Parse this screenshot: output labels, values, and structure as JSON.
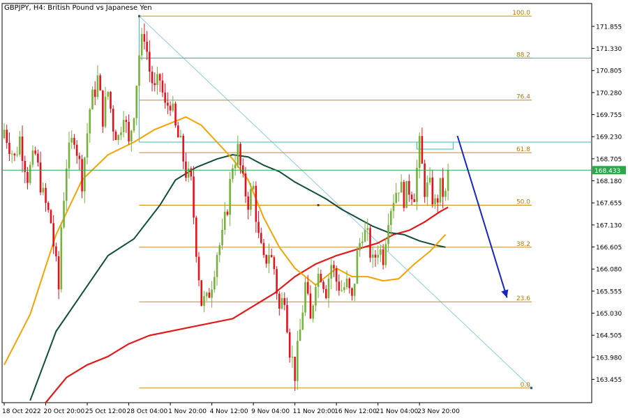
{
  "header": {
    "title": "GBPJPY, H4:  British Pound vs Japanese Yen"
  },
  "colors": {
    "bull": "#74b33a",
    "bear": "#e8101c",
    "ma_orange": "#f5a300",
    "ma_darkgreen": "#0f4f3a",
    "ma_red": "#e21a1a",
    "fib": "#c98a12",
    "cyan": "#35bcc1",
    "current_line": "#2aa84a",
    "arrow": "#1625c8"
  },
  "icons": {
    "projection_arrow": "arrow-down-icon"
  },
  "chart_data": {
    "type": "candlestick",
    "symbol": "GBPJPY",
    "timeframe": "H4",
    "ylim": [
      162.9,
      172.4
    ],
    "y_ticks": [
      171.855,
      171.33,
      170.805,
      170.28,
      169.755,
      169.23,
      168.705,
      168.18,
      167.655,
      167.13,
      166.605,
      166.08,
      165.555,
      165.03,
      164.505,
      163.98,
      163.455
    ],
    "x_ticks": [
      "18 Oct 2022",
      "20 Oct 20:00",
      "25 Oct 12:00",
      "28 Oct 04:00",
      "1 Nov 20:00",
      "4 Nov 12:00",
      "9 Nov 04:00",
      "11 Nov 20:00",
      "16 Nov 12:00",
      "21 Nov 04:00",
      "23 Nov 20:00"
    ],
    "x_tick_bars": [
      0,
      16,
      32,
      48,
      64,
      80,
      96,
      112,
      128,
      144,
      160
    ],
    "n_bars": 172,
    "current_price": 168.433,
    "current_price_label": "168.433",
    "fibonacci": {
      "start_bar": 52,
      "end_bar": 190,
      "levels": [
        {
          "label": "100.0",
          "price": 172.1
        },
        {
          "label": "88.2",
          "price": 171.1
        },
        {
          "label": "76.4",
          "price": 170.1
        },
        {
          "label": "61.8",
          "price": 168.85
        },
        {
          "label": "50.0",
          "price": 167.6
        },
        {
          "label": "38.2",
          "price": 166.6
        },
        {
          "label": "23.6",
          "price": 165.3
        },
        {
          "label": "0.0",
          "price": 163.25
        }
      ],
      "high": {
        "bar": 52,
        "price": 172.1
      },
      "low": {
        "bar": 190,
        "price": 163.25
      },
      "mid_marker": {
        "bar": 121,
        "price": 167.6
      }
    },
    "cyan_lines": [
      171.1,
      169.1
    ],
    "supply_zone": {
      "x_start_bar": 159,
      "x_end_bar": 173,
      "y_top": 169.1,
      "y_bottom": 168.98
    },
    "projection_arrow": {
      "from_bar": 173,
      "from_price": 169.25,
      "to_bar": 191,
      "to_price": 165.4
    },
    "candle_key": [
      [
        0,
        169.4
      ],
      [
        4,
        168.7
      ],
      [
        6,
        169.2
      ],
      [
        9,
        168.3
      ],
      [
        12,
        168.8
      ],
      [
        15,
        167.8
      ],
      [
        18,
        167.2
      ],
      [
        21,
        165.6
      ],
      [
        22,
        167.1
      ],
      [
        24,
        168.6
      ],
      [
        27,
        169.3
      ],
      [
        30,
        168.2
      ],
      [
        33,
        169.9
      ],
      [
        36,
        170.6
      ],
      [
        38,
        169.7
      ],
      [
        40,
        170.3
      ],
      [
        42,
        169.5
      ],
      [
        44,
        169.2
      ],
      [
        46,
        169.9
      ],
      [
        48,
        169.0
      ],
      [
        50,
        169.9
      ],
      [
        52,
        171.2
      ],
      [
        54,
        171.7
      ],
      [
        56,
        170.8
      ],
      [
        58,
        170.3
      ],
      [
        60,
        170.6
      ],
      [
        62,
        169.9
      ],
      [
        64,
        170.1
      ],
      [
        66,
        169.4
      ],
      [
        68,
        169.0
      ],
      [
        70,
        168.4
      ],
      [
        72,
        168.1
      ],
      [
        74,
        166.6
      ],
      [
        76,
        165.3
      ],
      [
        78,
        165.3
      ],
      [
        80,
        165.8
      ],
      [
        82,
        166.5
      ],
      [
        84,
        166.8
      ],
      [
        86,
        167.6
      ],
      [
        88,
        168.6
      ],
      [
        90,
        168.9
      ],
      [
        92,
        168.1
      ],
      [
        94,
        167.7
      ],
      [
        96,
        168.0
      ],
      [
        98,
        166.8
      ],
      [
        100,
        166.2
      ],
      [
        102,
        166.5
      ],
      [
        104,
        166.1
      ],
      [
        106,
        165.1
      ],
      [
        108,
        165.5
      ],
      [
        110,
        164.2
      ],
      [
        112,
        163.6
      ],
      [
        114,
        164.6
      ],
      [
        116,
        165.7
      ],
      [
        118,
        164.8
      ],
      [
        120,
        165.9
      ],
      [
        122,
        166.0
      ],
      [
        124,
        165.6
      ],
      [
        126,
        166.2
      ],
      [
        128,
        165.8
      ],
      [
        130,
        165.6
      ],
      [
        132,
        165.7
      ],
      [
        134,
        165.3
      ],
      [
        136,
        166.4
      ],
      [
        138,
        167.0
      ],
      [
        140,
        166.8
      ],
      [
        142,
        166.2
      ],
      [
        144,
        166.6
      ],
      [
        146,
        166.4
      ],
      [
        148,
        167.4
      ],
      [
        150,
        167.8
      ],
      [
        152,
        168.1
      ],
      [
        154,
        167.8
      ],
      [
        156,
        168.0
      ],
      [
        158,
        167.9
      ],
      [
        160,
        169.0
      ],
      [
        162,
        168.0
      ],
      [
        164,
        168.0
      ],
      [
        166,
        167.6
      ],
      [
        168,
        168.0
      ],
      [
        170,
        167.8
      ],
      [
        171,
        168.433
      ]
    ],
    "ma_orange": [
      [
        0,
        163.8
      ],
      [
        10,
        165.0
      ],
      [
        20,
        166.9
      ],
      [
        30,
        168.2
      ],
      [
        40,
        168.8
      ],
      [
        50,
        169.1
      ],
      [
        58,
        169.4
      ],
      [
        66,
        169.6
      ],
      [
        70,
        169.7
      ],
      [
        76,
        169.5
      ],
      [
        82,
        169.1
      ],
      [
        88,
        168.7
      ],
      [
        94,
        168.2
      ],
      [
        100,
        167.3
      ],
      [
        106,
        166.6
      ],
      [
        112,
        166.1
      ],
      [
        120,
        165.7
      ],
      [
        128,
        166.1
      ],
      [
        134,
        165.9
      ],
      [
        140,
        165.9
      ],
      [
        146,
        165.8
      ],
      [
        152,
        165.85
      ],
      [
        158,
        166.2
      ],
      [
        164,
        166.5
      ],
      [
        170,
        166.9
      ]
    ],
    "ma_darkgreen": [
      [
        10,
        162.95
      ],
      [
        20,
        164.6
      ],
      [
        30,
        165.5
      ],
      [
        40,
        166.4
      ],
      [
        50,
        166.8
      ],
      [
        60,
        167.6
      ],
      [
        66,
        168.2
      ],
      [
        74,
        168.5
      ],
      [
        82,
        168.7
      ],
      [
        88,
        168.8
      ],
      [
        94,
        168.75
      ],
      [
        100,
        168.55
      ],
      [
        106,
        168.4
      ],
      [
        112,
        168.15
      ],
      [
        118,
        167.95
      ],
      [
        124,
        167.75
      ],
      [
        130,
        167.5
      ],
      [
        136,
        167.3
      ],
      [
        142,
        167.1
      ],
      [
        148,
        166.95
      ],
      [
        154,
        166.9
      ],
      [
        160,
        166.75
      ],
      [
        166,
        166.65
      ],
      [
        170,
        166.6
      ]
    ],
    "ma_red": [
      [
        16,
        162.9
      ],
      [
        24,
        163.5
      ],
      [
        32,
        163.8
      ],
      [
        40,
        164.0
      ],
      [
        48,
        164.3
      ],
      [
        56,
        164.5
      ],
      [
        64,
        164.6
      ],
      [
        72,
        164.7
      ],
      [
        80,
        164.8
      ],
      [
        88,
        164.9
      ],
      [
        96,
        165.2
      ],
      [
        104,
        165.5
      ],
      [
        112,
        165.9
      ],
      [
        120,
        166.2
      ],
      [
        128,
        166.4
      ],
      [
        136,
        166.55
      ],
      [
        144,
        166.7
      ],
      [
        150,
        166.9
      ],
      [
        156,
        167.0
      ],
      [
        162,
        167.2
      ],
      [
        168,
        167.45
      ],
      [
        171,
        167.55
      ]
    ]
  }
}
